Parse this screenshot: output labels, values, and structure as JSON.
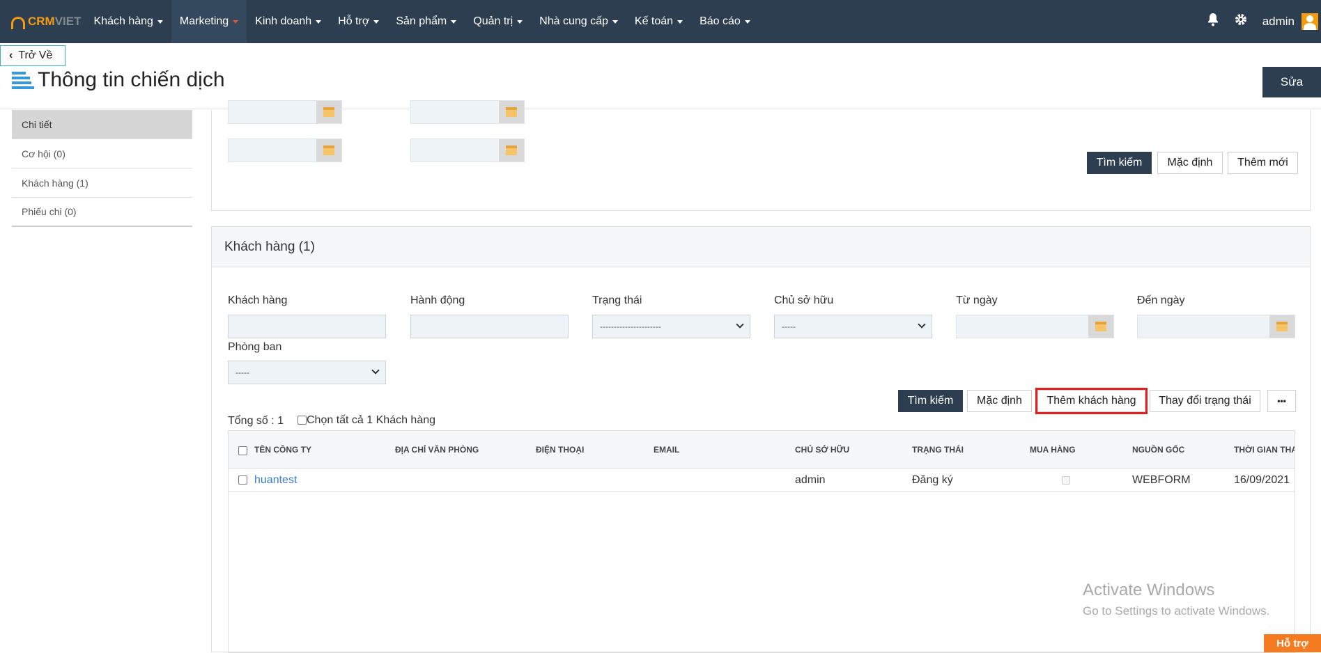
{
  "brand": {
    "crm": "CRM",
    "viet": "VIET"
  },
  "nav": {
    "items": [
      "Khách hàng",
      "Marketing",
      "Kinh doanh",
      "Hỗ trợ",
      "Sản phẩm",
      "Quản trị",
      "Nhà cung cấp",
      "Kế toán",
      "Báo cáo"
    ],
    "active": "Marketing",
    "user": "admin",
    "icons": [
      "bell-icon",
      "gear-icon",
      "avatar"
    ]
  },
  "back_label": "Trở Về",
  "page_title": "Thông tin chiến dịch",
  "edit_label": "Sửa",
  "sidebar": {
    "items": [
      "Chi tiết",
      "Cơ hội (0)",
      "Khách hàng (1)",
      "Phiếu chi (0)"
    ],
    "active": "Chi tiết"
  },
  "top_panel": {
    "search_label": "Tìm kiếm",
    "default_label": "Mặc định",
    "new_label": "Thêm mới"
  },
  "customer_panel": {
    "title": "Khách hàng (1)",
    "filters": {
      "customer": "Khách hàng",
      "action": "Hành động",
      "status": "Trạng thái",
      "status_value": "----------------------",
      "owner": "Chủ sở hữu",
      "owner_value": "-----",
      "from_date": "Từ ngày",
      "to_date": "Đến ngày",
      "department": "Phòng ban",
      "department_value": "-----"
    },
    "buttons": {
      "search": "Tìm kiếm",
      "default": "Mặc định",
      "add_customer": "Thêm khách hàng",
      "change_status": "Thay đổi trạng thái",
      "more": "•••"
    },
    "total": "Tổng số : 1",
    "select_all": "Chọn tất cả 1 Khách hàng",
    "columns": [
      "TÊN CÔNG TY",
      "ĐỊA CHỈ VĂN PHÒNG",
      "ĐIỆN THOẠI",
      "EMAIL",
      "CHỦ SỞ HỮU",
      "TRẠNG THÁI",
      "MUA HÀNG",
      "NGUỒN GỐC",
      "THỜI GIAN THA"
    ],
    "rows": [
      {
        "company": "huantest",
        "address": "",
        "phone": "",
        "email": "",
        "owner": "admin",
        "status": "Đăng ký",
        "purchase": false,
        "source": "WEBFORM",
        "time": "16/09/2021"
      }
    ]
  },
  "watermark": {
    "line1": "Activate Windows",
    "line2": "Go to Settings to activate Windows."
  },
  "support_label": "Hỗ trợ",
  "colors": {
    "nav_bg": "#2c3e50",
    "accent_orange": "#f39c12",
    "link_blue": "#3a7bd5",
    "highlight_red": "#e02020",
    "support_orange": "#f47b20"
  }
}
